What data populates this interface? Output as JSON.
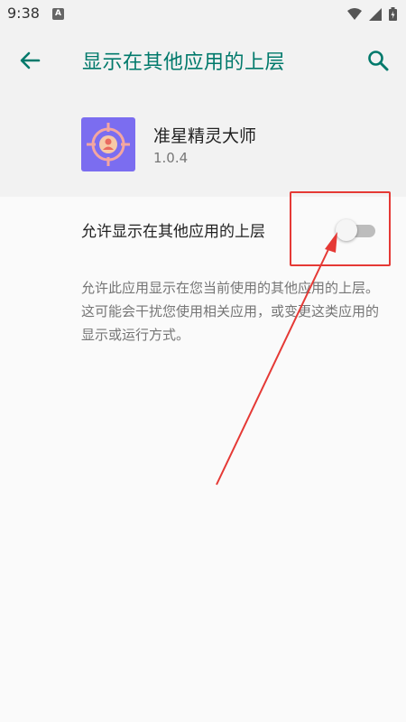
{
  "status_bar": {
    "time": "9:38",
    "notification_badge": "A",
    "icons": [
      "wifi-icon",
      "signal-icon",
      "battery-icon"
    ]
  },
  "app_bar": {
    "title": "显示在其他应用的上层",
    "back_icon": "arrow-left-icon",
    "search_icon": "search-icon",
    "accent_color": "#00796b"
  },
  "app_info": {
    "name": "准星精灵大师",
    "version": "1.0.4",
    "icon": "crosshair-icon",
    "icon_bg": "#7b6df0"
  },
  "preference": {
    "title": "允许显示在其他应用的上层",
    "enabled": false,
    "summary": "允许此应用显示在您当前使用的其他应用的上层。这可能会干扰您使用相关应用，或变更这类应用的显示或运行方式。"
  },
  "annotation": {
    "color": "#e53935"
  }
}
